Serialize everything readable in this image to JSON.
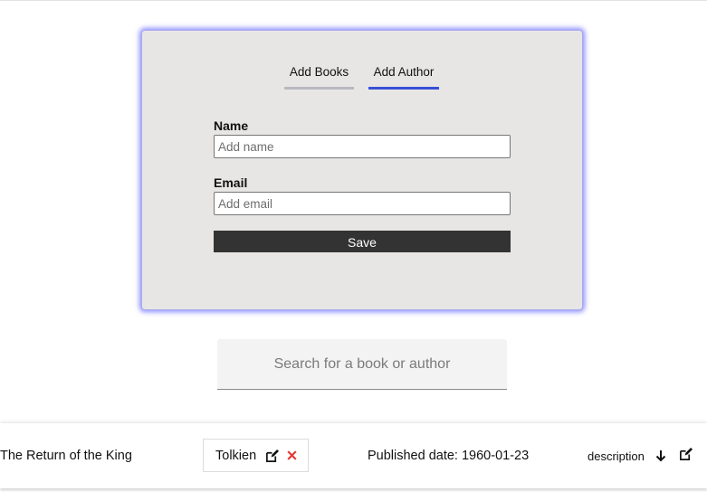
{
  "tabs": [
    {
      "label": "Add Books"
    },
    {
      "label": "Add Author"
    }
  ],
  "form": {
    "name_label": "Name",
    "name_placeholder": "Add name",
    "email_label": "Email",
    "email_placeholder": "Add email",
    "save_label": "Save"
  },
  "search": {
    "placeholder": "Search for a book or author"
  },
  "books": [
    {
      "title": "The Return of the King",
      "author": "Tolkien",
      "published": "Published date: 1960-01-23",
      "description_label": "description"
    }
  ],
  "colors": {
    "active_tab": "#3a4fd8",
    "inactive_tab": "#b8b8c0",
    "delete": "#e53935",
    "card_glow": "#8c8cff"
  },
  "icons": [
    "edit-icon",
    "close-icon",
    "arrow-down-icon"
  ]
}
